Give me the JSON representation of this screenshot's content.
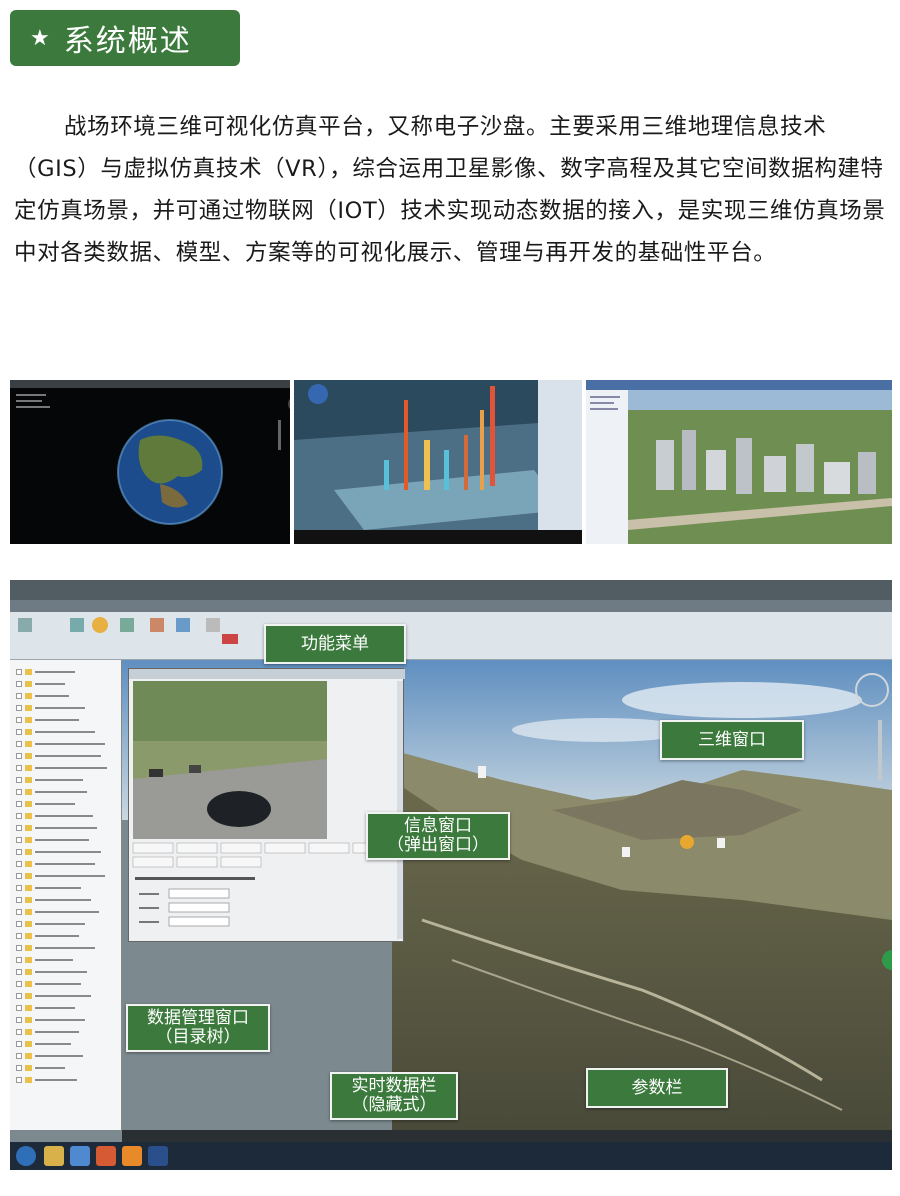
{
  "section": {
    "star": "★",
    "title": "系统概述"
  },
  "intro": {
    "text": "战场环境三维可视化仿真平台，又称电子沙盘。主要采用三维地理信息技术（GIS）与虚拟仿真技术（VR），综合运用卫星影像、数字高程及其它空间数据构建特定仿真场景，并可通过物联网（IOT）技术实现动态数据的接入，是实现三维仿真场景中对各类数据、模型、方案等的可视化展示、管理与再开发的基础性平台。"
  },
  "callouts": {
    "menu": "功能菜单",
    "window3d": "三维窗口",
    "info_line1": "信息窗口",
    "info_line2": "（弹出窗口）",
    "data_line1": "数据管理窗口",
    "data_line2": "（目录树）",
    "realtime_line1": "实时数据栏",
    "realtime_line2": "（隐藏式）",
    "params": "参数栏"
  },
  "colors": {
    "accent_green": "#3b7a3c",
    "callout_border": "#f2f2f2"
  }
}
